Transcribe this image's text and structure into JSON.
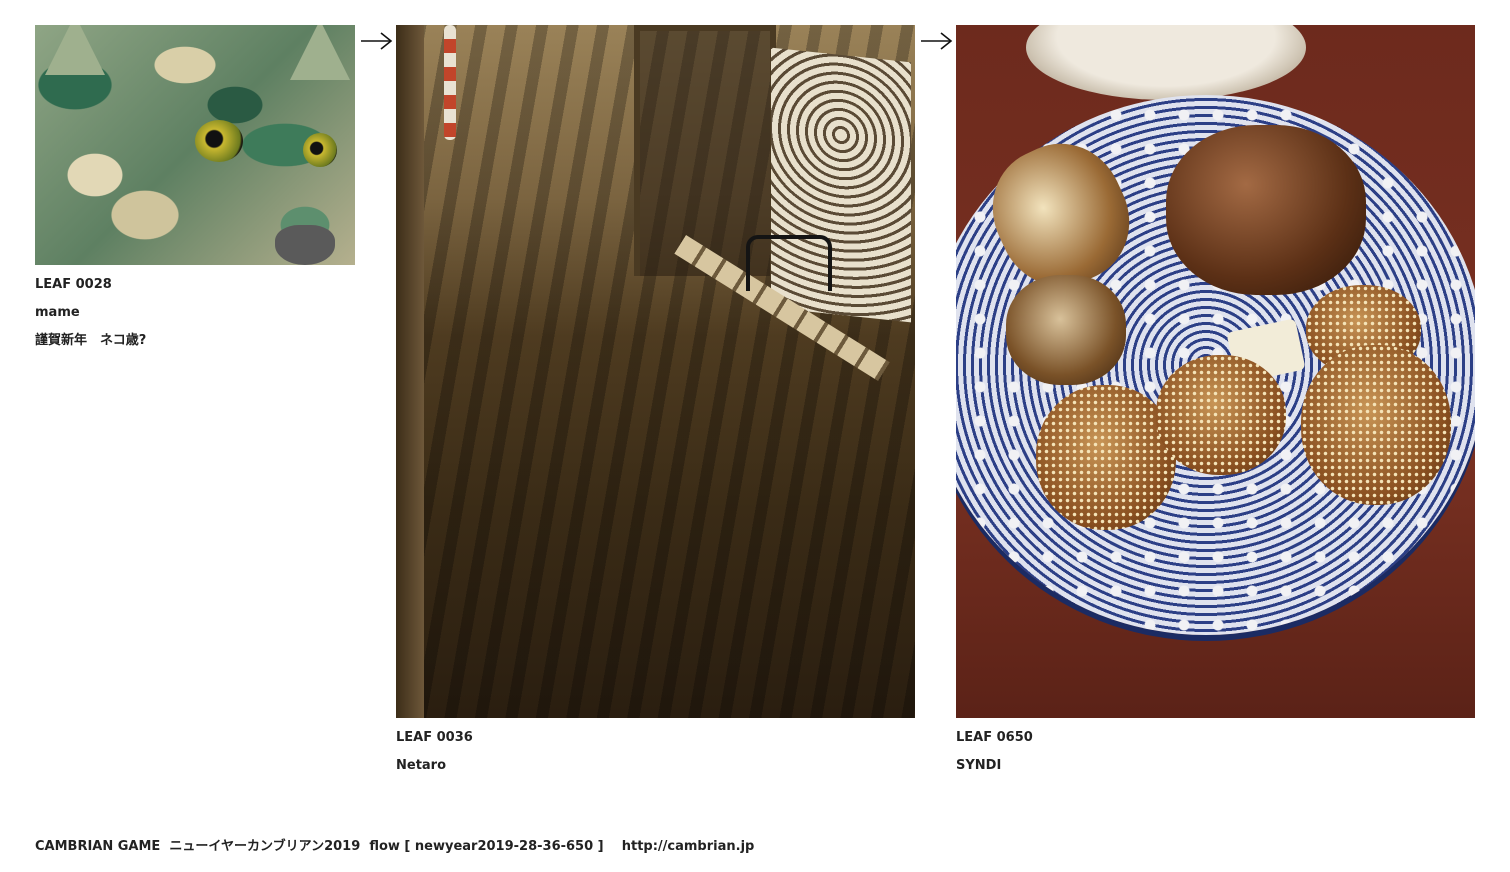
{
  "leaves": [
    {
      "title": "LEAF 0028",
      "author": "mame",
      "caption": "謹賀新年　ネコ歳?"
    },
    {
      "title": "LEAF 0036",
      "author": "Netaro"
    },
    {
      "title": "LEAF 0650",
      "author": "SYNDI"
    }
  ],
  "arrows": [
    "right-arrow",
    "right-arrow"
  ],
  "footer": {
    "site": "CAMBRIAN GAME",
    "event": "ニューイヤーカンブリアン2019",
    "flow": "flow [ newyear2019-28-36-650 ]",
    "url": "http://cambrian.jp"
  }
}
